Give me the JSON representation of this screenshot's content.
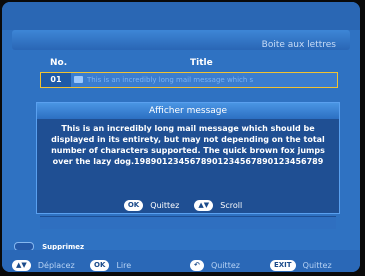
{
  "app": {
    "title": "Boite aux lettres"
  },
  "table": {
    "col_no": "No.",
    "col_title": "Title",
    "rows": [
      {
        "no": "01",
        "title": "This is an incredibly long mail message which s"
      }
    ]
  },
  "dialog": {
    "header": "Afficher message",
    "body": "This is an incredibly long mail message which should be displayed in its entirety, but may not depending on the total number of characters supported. The quick brown fox jumps over the lazy dog.1989012345678901234567890123456789",
    "ok_key": "OK",
    "ok_label": "Quittez",
    "scroll_label": "Scroll"
  },
  "delete": {
    "label": "Supprimez"
  },
  "bottom": {
    "move_label": "Déplacez",
    "ok_key": "OK",
    "read_label": "Lire",
    "back_label": "Quittez",
    "exit_key": "EXIT",
    "exit_label": "Quittez"
  },
  "colors": {
    "background": "#2f72c2",
    "dialog": "#1f4f93",
    "selection": "#f1c232"
  }
}
